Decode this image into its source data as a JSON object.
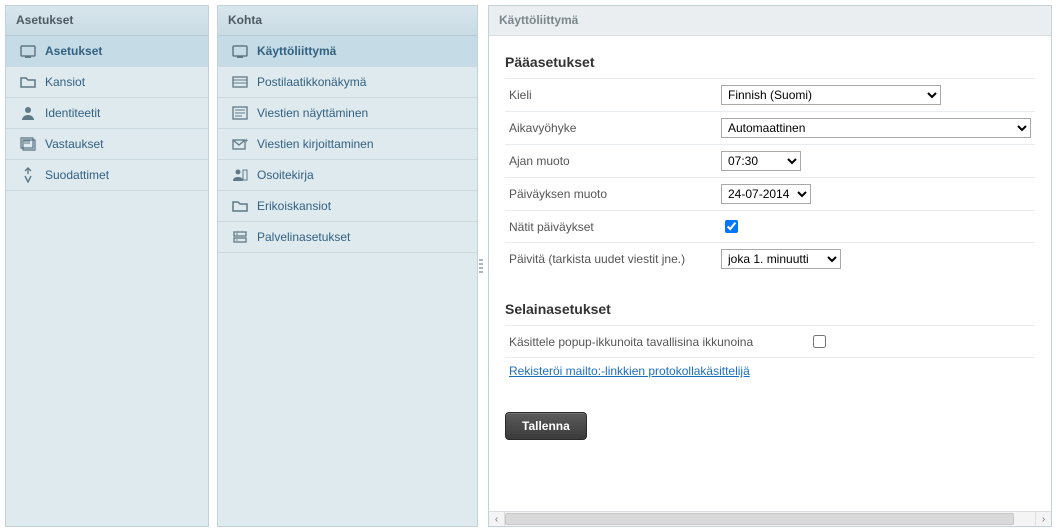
{
  "columns": {
    "settings_title": "Asetukset",
    "section_title": "Kohta",
    "main_title": "Käyttöliittymä"
  },
  "settings_list": {
    "items": [
      {
        "label": "Asetukset",
        "icon": "prefs",
        "selected": true
      },
      {
        "label": "Kansiot",
        "icon": "folder",
        "selected": false
      },
      {
        "label": "Identiteetit",
        "icon": "identity",
        "selected": false
      },
      {
        "label": "Vastaukset",
        "icon": "responses",
        "selected": false
      },
      {
        "label": "Suodattimet",
        "icon": "filters",
        "selected": false
      }
    ]
  },
  "section_list": {
    "items": [
      {
        "label": "Käyttöliittymä",
        "icon": "ui",
        "selected": true
      },
      {
        "label": "Postilaatikkonäkymä",
        "icon": "mailbox",
        "selected": false
      },
      {
        "label": "Viestien näyttäminen",
        "icon": "display",
        "selected": false
      },
      {
        "label": "Viestien kirjoittaminen",
        "icon": "compose",
        "selected": false
      },
      {
        "label": "Osoitekirja",
        "icon": "contacts",
        "selected": false
      },
      {
        "label": "Erikoiskansiot",
        "icon": "special",
        "selected": false
      },
      {
        "label": "Palvelinasetukset",
        "icon": "server",
        "selected": false
      }
    ]
  },
  "form": {
    "main_heading": "Pääasetukset",
    "language_label": "Kieli",
    "language_value": "Finnish (Suomi)",
    "timezone_label": "Aikavyöhyke",
    "timezone_value": "Automaattinen",
    "timeformat_label": "Ajan muoto",
    "timeformat_value": "07:30",
    "dateformat_label": "Päiväyksen muoto",
    "dateformat_value": "24-07-2014",
    "prettydate_label": "Nätit päiväykset",
    "prettydate_checked": true,
    "refresh_label": "Päivitä (tarkista uudet viestit jne.)",
    "refresh_value": "joka 1. minuutti",
    "browser_heading": "Selainasetukset",
    "popup_label": "Käsittele popup-ikkunoita tavallisina ikkunoina",
    "popup_checked": false,
    "mailto_link": "Rekisteröi mailto:-linkkien protokollakäsittelijä",
    "save_label": "Tallenna"
  }
}
